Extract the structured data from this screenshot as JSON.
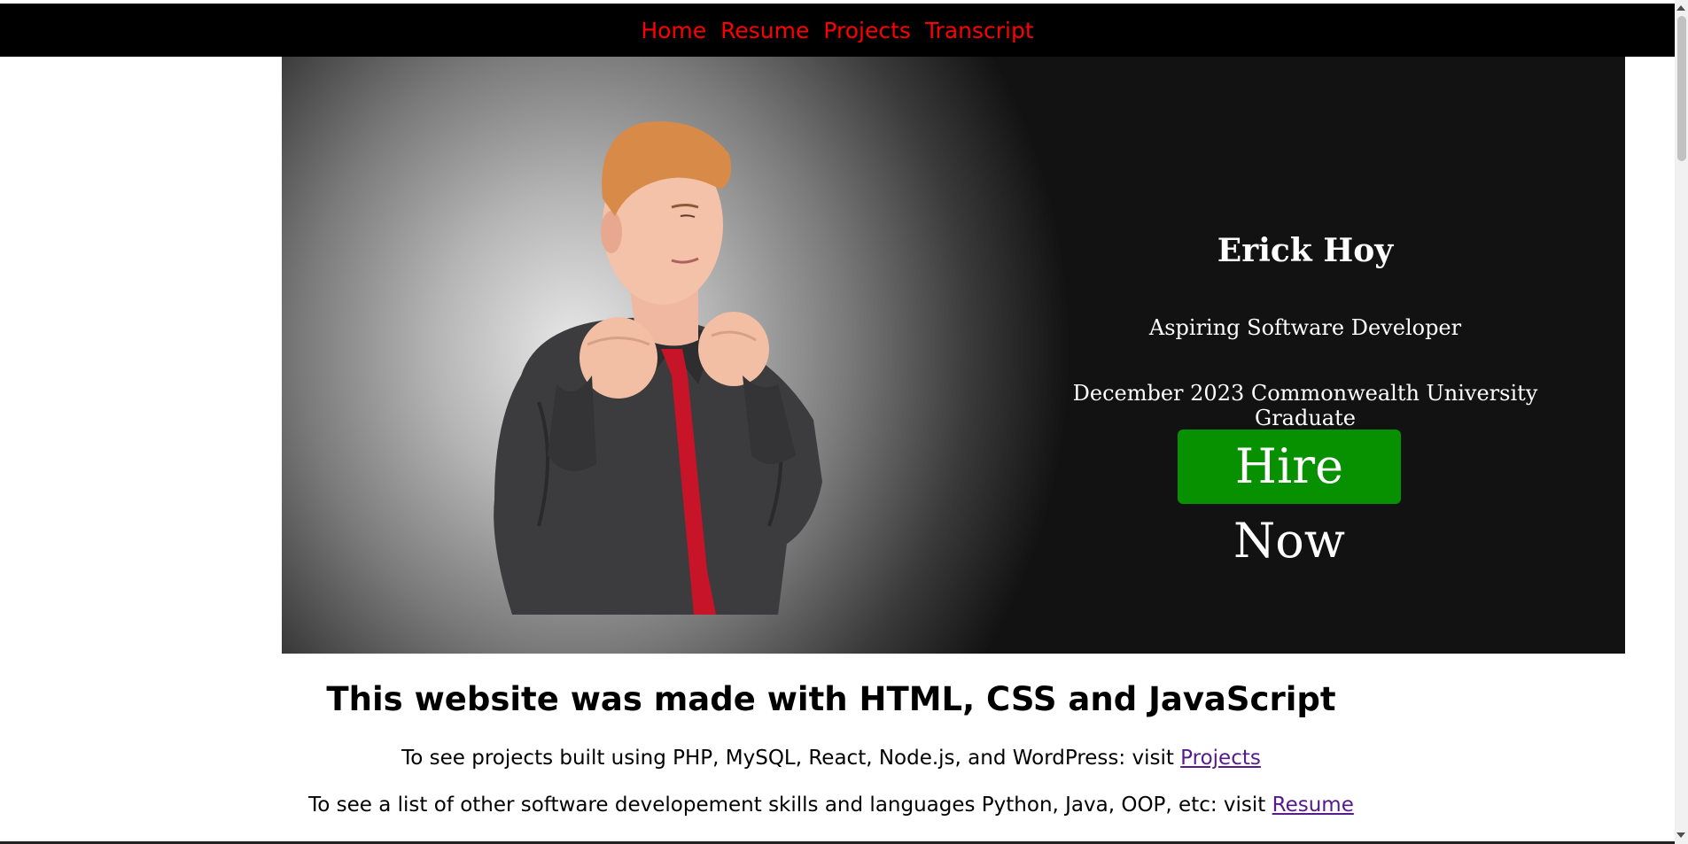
{
  "nav": {
    "items": [
      {
        "label": "Home"
      },
      {
        "label": "Resume"
      },
      {
        "label": "Projects"
      },
      {
        "label": "Transcript"
      }
    ],
    "link_color": "#ff0000",
    "background": "#000000"
  },
  "hero": {
    "name": "Erick Hoy",
    "role": "Aspiring Software Developer",
    "graduation": "December 2023 Commonwealth University Graduate",
    "hire_button": "Hire Now",
    "hire_button_color": "#079000"
  },
  "content": {
    "heading": "This website was made with HTML, CSS and JavaScript",
    "line1_text": "To see projects built using PHP, MySQL, React, Node.js, and WordPress: visit ",
    "line1_link": "Projects",
    "line2_text": "To see a list of other software developement skills and languages Python, Java, OOP, etc: visit ",
    "line2_link": "Resume",
    "link_color": "#551a8b"
  }
}
